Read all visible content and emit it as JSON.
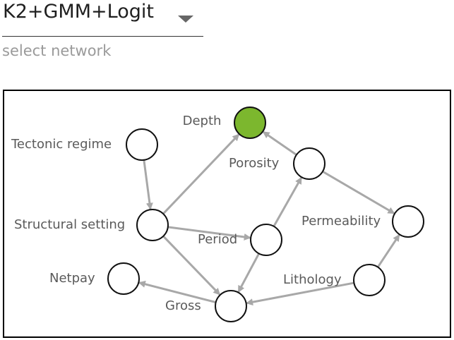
{
  "select": {
    "value": "K2+GMM+Logit",
    "helper": "select network"
  },
  "colors": {
    "edge": "#a8a8a8",
    "node_fill": "#ffffff",
    "node_stroke": "#111111",
    "highlight_fill": "#7cb72e",
    "highlight_label": "#8fc552",
    "label": "#5a5a5a"
  },
  "network": {
    "nodes": [
      {
        "id": "depth",
        "label": "Depth",
        "highlighted": true
      },
      {
        "id": "tectonic",
        "label": "Tectonic regime"
      },
      {
        "id": "porosity",
        "label": "Porosity"
      },
      {
        "id": "structural",
        "label": "Structural setting"
      },
      {
        "id": "period",
        "label": "Period"
      },
      {
        "id": "permeability",
        "label": "Permeability"
      },
      {
        "id": "netpay",
        "label": "Netpay"
      },
      {
        "id": "lithology",
        "label": "Lithology"
      },
      {
        "id": "gross",
        "label": "Gross"
      }
    ],
    "edges": [
      {
        "from": "tectonic",
        "to": "structural"
      },
      {
        "from": "structural",
        "to": "depth"
      },
      {
        "from": "structural",
        "to": "period"
      },
      {
        "from": "structural",
        "to": "gross"
      },
      {
        "from": "porosity",
        "to": "depth"
      },
      {
        "from": "porosity",
        "to": "permeability"
      },
      {
        "from": "period",
        "to": "porosity"
      },
      {
        "from": "period",
        "to": "gross"
      },
      {
        "from": "lithology",
        "to": "permeability"
      },
      {
        "from": "lithology",
        "to": "gross"
      },
      {
        "from": "gross",
        "to": "netpay"
      }
    ]
  }
}
